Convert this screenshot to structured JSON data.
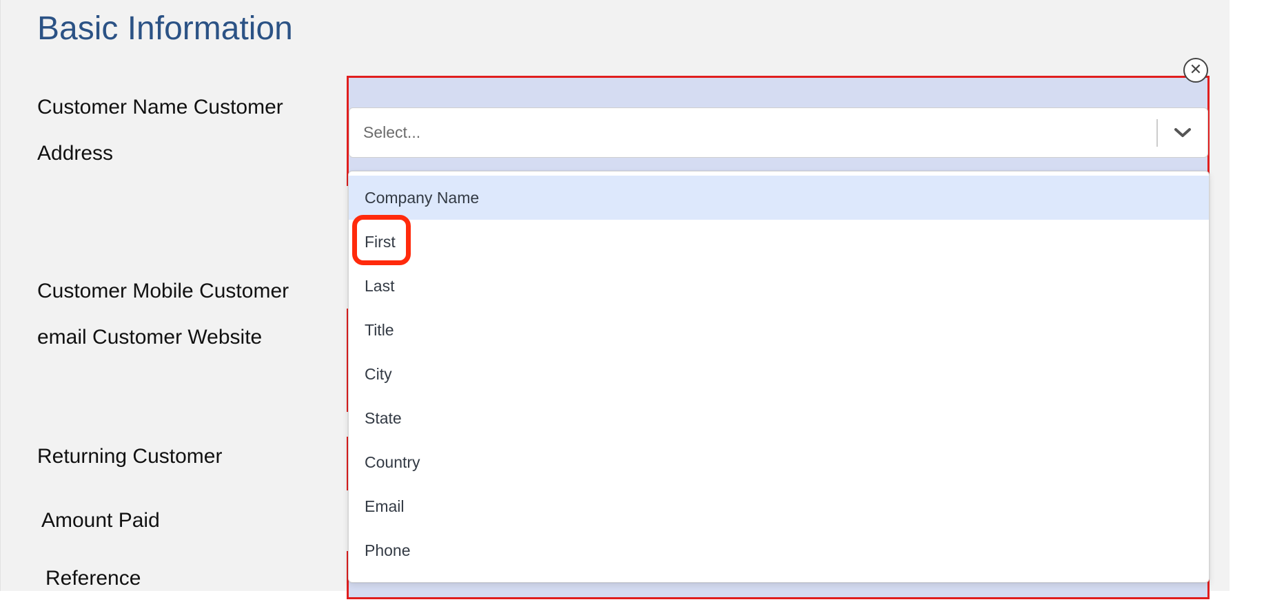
{
  "section": {
    "title": "Basic Information"
  },
  "labels": {
    "customer_name_address": "Customer Name Customer Address",
    "customer_contact": "Customer Mobile  Customer email Customer Website",
    "returning_customer": "Returning Customer",
    "amount_paid": "Amount Paid",
    "reference": "Reference"
  },
  "select": {
    "placeholder": "Select...",
    "clear_icon": "close-circle-icon",
    "indicator_icon": "chevron-down-icon",
    "options": [
      "Company Name",
      "First",
      "Last",
      "Title",
      "City",
      "State",
      "Country",
      "Email",
      "Phone"
    ],
    "focused_option": "Company Name",
    "annotated_option": "First"
  },
  "colors": {
    "title": "#2b5285",
    "field_border": "#e01e1e",
    "field_fill": "#d5dcf2",
    "focused_option_bg": "#dde8fc",
    "highlight_ring": "#ff2a0c"
  }
}
